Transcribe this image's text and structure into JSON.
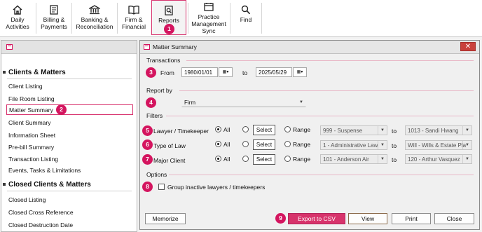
{
  "ribbon": {
    "daily": "Daily\nActivities",
    "billing": "Billing &\nPayments",
    "banking": "Banking &\nReconciliation",
    "firm": "Firm &\nFinancial",
    "reports": "Reports",
    "practice": "Practice\nManagement\nSync",
    "find": "Find"
  },
  "badges": [
    "1",
    "2",
    "3",
    "4",
    "5",
    "6",
    "7",
    "8",
    "9"
  ],
  "left_panel": {
    "sections": [
      {
        "title": "Clients & Matters",
        "items": [
          "Client Listing",
          "File Room Listing",
          "Matter Summary",
          "Client Summary",
          "Information Sheet",
          "Pre-bill Summary",
          "Transaction Listing",
          "Events, Tasks & Limitations"
        ]
      },
      {
        "title": "Closed Clients & Matters",
        "items": [
          "Closed Listing",
          "Closed Cross Reference",
          "Closed Destruction Date"
        ]
      }
    ],
    "selected": "Matter Summary"
  },
  "dialog": {
    "title": "Matter Summary",
    "close_glyph": "✕",
    "transactions": {
      "heading": "Transactions",
      "from_label": "From",
      "from_value": "1980/01/01",
      "to_label": "to",
      "to_value": "2025/05/29"
    },
    "report_by": {
      "heading": "Report by",
      "value": "Firm"
    },
    "filters": {
      "heading": "Filters",
      "all_label": "All",
      "select_label": "Select",
      "range_label": "Range",
      "to_label": "to",
      "rows": [
        {
          "label": "Lawyer / Timekeeper",
          "from": "999 - Suspense",
          "to": "1013 - Sandi Hwang"
        },
        {
          "label": "Type of Law",
          "from": "1 - Administrative Law",
          "to": "Will - Wills & Estate Pla"
        },
        {
          "label": "Major Client",
          "from": "101 - Anderson Air",
          "to": "120 - Arthur Vasquez"
        }
      ]
    },
    "options": {
      "heading": "Options",
      "group_inactive": "Group inactive lawyers / timekeepers"
    },
    "buttons": {
      "memorize": "Memorize",
      "export_csv": "Export to CSV",
      "view": "View",
      "print": "Print",
      "close": "Close"
    }
  },
  "colors": {
    "accent": "#d4155f",
    "highlight_border": "#d8336e",
    "section_line": "#e8b7c6"
  },
  "icons": [
    "home-icon",
    "billing-icon",
    "bank-icon",
    "book-icon",
    "report-icon",
    "sync-icon",
    "search-icon",
    "calendar-icon",
    "dropdown-arrow-icon",
    "close-icon",
    "window-icon"
  ]
}
